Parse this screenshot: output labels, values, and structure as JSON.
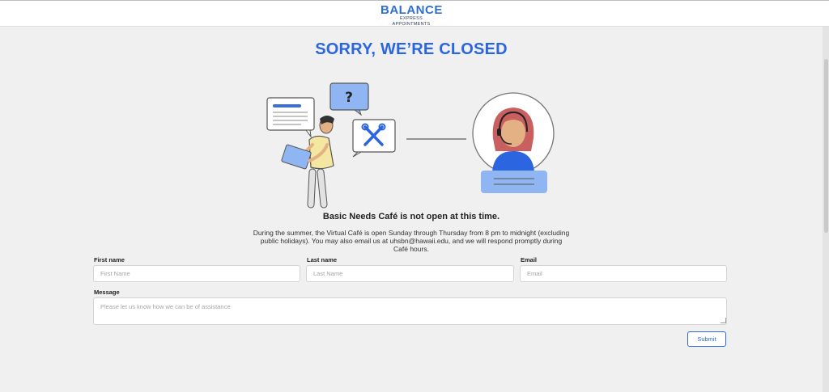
{
  "header": {
    "logo_main": "BALANCE",
    "logo_sub": "EXPRESS APPOINTMENTS"
  },
  "main": {
    "headline": "SORRY, WE’RE CLOSED",
    "illustration_icons": [
      "chat-bubble-icon",
      "question-mark-icon",
      "tools-icon",
      "support-agent-icon"
    ],
    "subhead": "Basic Needs Café is not open at this time.",
    "body": "During the summer, the Virtual Café is open Sunday through Thursday from 8 pm to midnight (excluding public holidays). You may also email us at uhsbn@hawaii.edu, and we will respond promptly during Café hours."
  },
  "form": {
    "first_name_label": "First name",
    "first_name_placeholder": "First Name",
    "first_name_value": "",
    "last_name_label": "Last name",
    "last_name_placeholder": "Last Name",
    "last_name_value": "",
    "email_label": "Email",
    "email_placeholder": "Email",
    "email_value": "",
    "message_label": "Message",
    "message_placeholder": "Please let us know how we can be of assistance",
    "message_value": "",
    "submit_label": "Submit"
  },
  "colors": {
    "accent": "#2b66e0",
    "background": "#f0f0f0",
    "illustration_blue": "#8fb5f2",
    "agent_hair": "#c95f5f",
    "skin": "#e3b183"
  }
}
